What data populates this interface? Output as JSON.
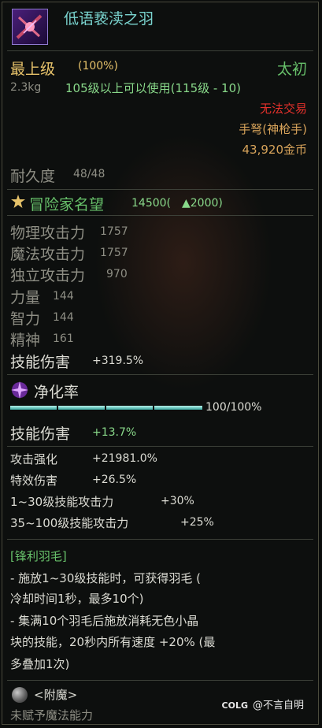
{
  "item": {
    "name": "低语亵渎之羽",
    "rarity": "最上级",
    "quality": "(100%)",
    "grade": "太初",
    "weight": "2.3kg",
    "level_req": "105级以上可以使用(115级 - 10)",
    "trade": "无法交易",
    "type": "手弩(神枪手)",
    "price": "43,920金币",
    "durability_label": "耐久度",
    "durability_value": "48/48"
  },
  "fame": {
    "label": "冒险家名望",
    "value": "14500(",
    "up": "▲2000)"
  },
  "stats": [
    {
      "label": "物理攻击力",
      "value": "1757"
    },
    {
      "label": "魔法攻击力",
      "value": "1757"
    },
    {
      "label": "独立攻击力",
      "value": "970"
    },
    {
      "label": "力量",
      "value": "144"
    },
    {
      "label": "智力",
      "value": "144"
    },
    {
      "label": "精神",
      "value": "161"
    },
    {
      "label": "技能伤害",
      "value": "+319.5%"
    }
  ],
  "purify": {
    "label": "净化率",
    "progress_text": "100/100%",
    "progress": 1.0,
    "skill_label": "技能伤害",
    "skill_value": "+13.7%"
  },
  "bonus": [
    {
      "label": "攻击强化",
      "value": "+21981.0%"
    },
    {
      "label": "特效伤害",
      "value": "+26.5%"
    },
    {
      "label": "1~30级技能攻击力",
      "value": "+30%"
    },
    {
      "label": "35~100级技能攻击力",
      "value": "+25%"
    }
  ],
  "feather": {
    "title": "[锋利羽毛]",
    "lines": [
      "- 施放1~30级技能时，可获得羽毛 (",
      "冷却时间1秒，最多10个)",
      "- 集满10个羽毛后施放消耗无色小晶",
      "块的技能，20秒内所有速度 +20% (最",
      "多叠加1次)"
    ]
  },
  "enchant": {
    "title": "<附魔>",
    "text": "未赋予魔法能力"
  },
  "watermark": {
    "logo": "COLG",
    "text": "@不言自明"
  }
}
